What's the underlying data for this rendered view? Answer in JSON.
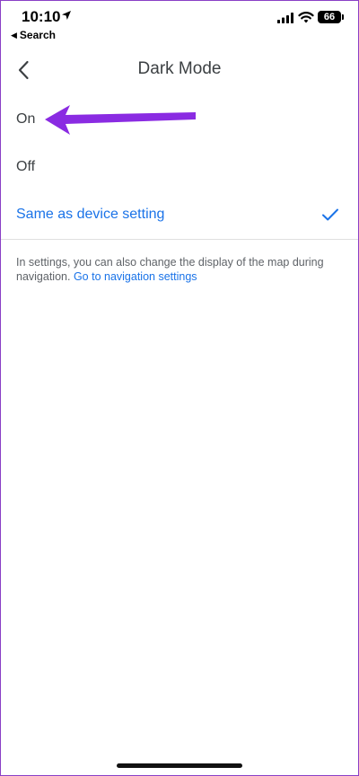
{
  "status_bar": {
    "time": "10:10",
    "back_app_label": "Search",
    "battery_level": "66",
    "icons": [
      "location-arrow-icon",
      "cellular-signal-icon",
      "wifi-icon",
      "battery-icon"
    ]
  },
  "header": {
    "title": "Dark Mode",
    "back_icon": "chevron-left-icon"
  },
  "options": [
    {
      "label": "On",
      "selected": false
    },
    {
      "label": "Off",
      "selected": false
    },
    {
      "label": "Same as device setting",
      "selected": true
    }
  ],
  "info": {
    "text": "In settings, you can also change the display of the map during navigation.",
    "link": "Go to navigation settings"
  },
  "colors": {
    "accent": "#1a73e8",
    "annotation_arrow": "#8a2be2",
    "text_primary": "#3c4043",
    "text_secondary": "#5f6368"
  }
}
